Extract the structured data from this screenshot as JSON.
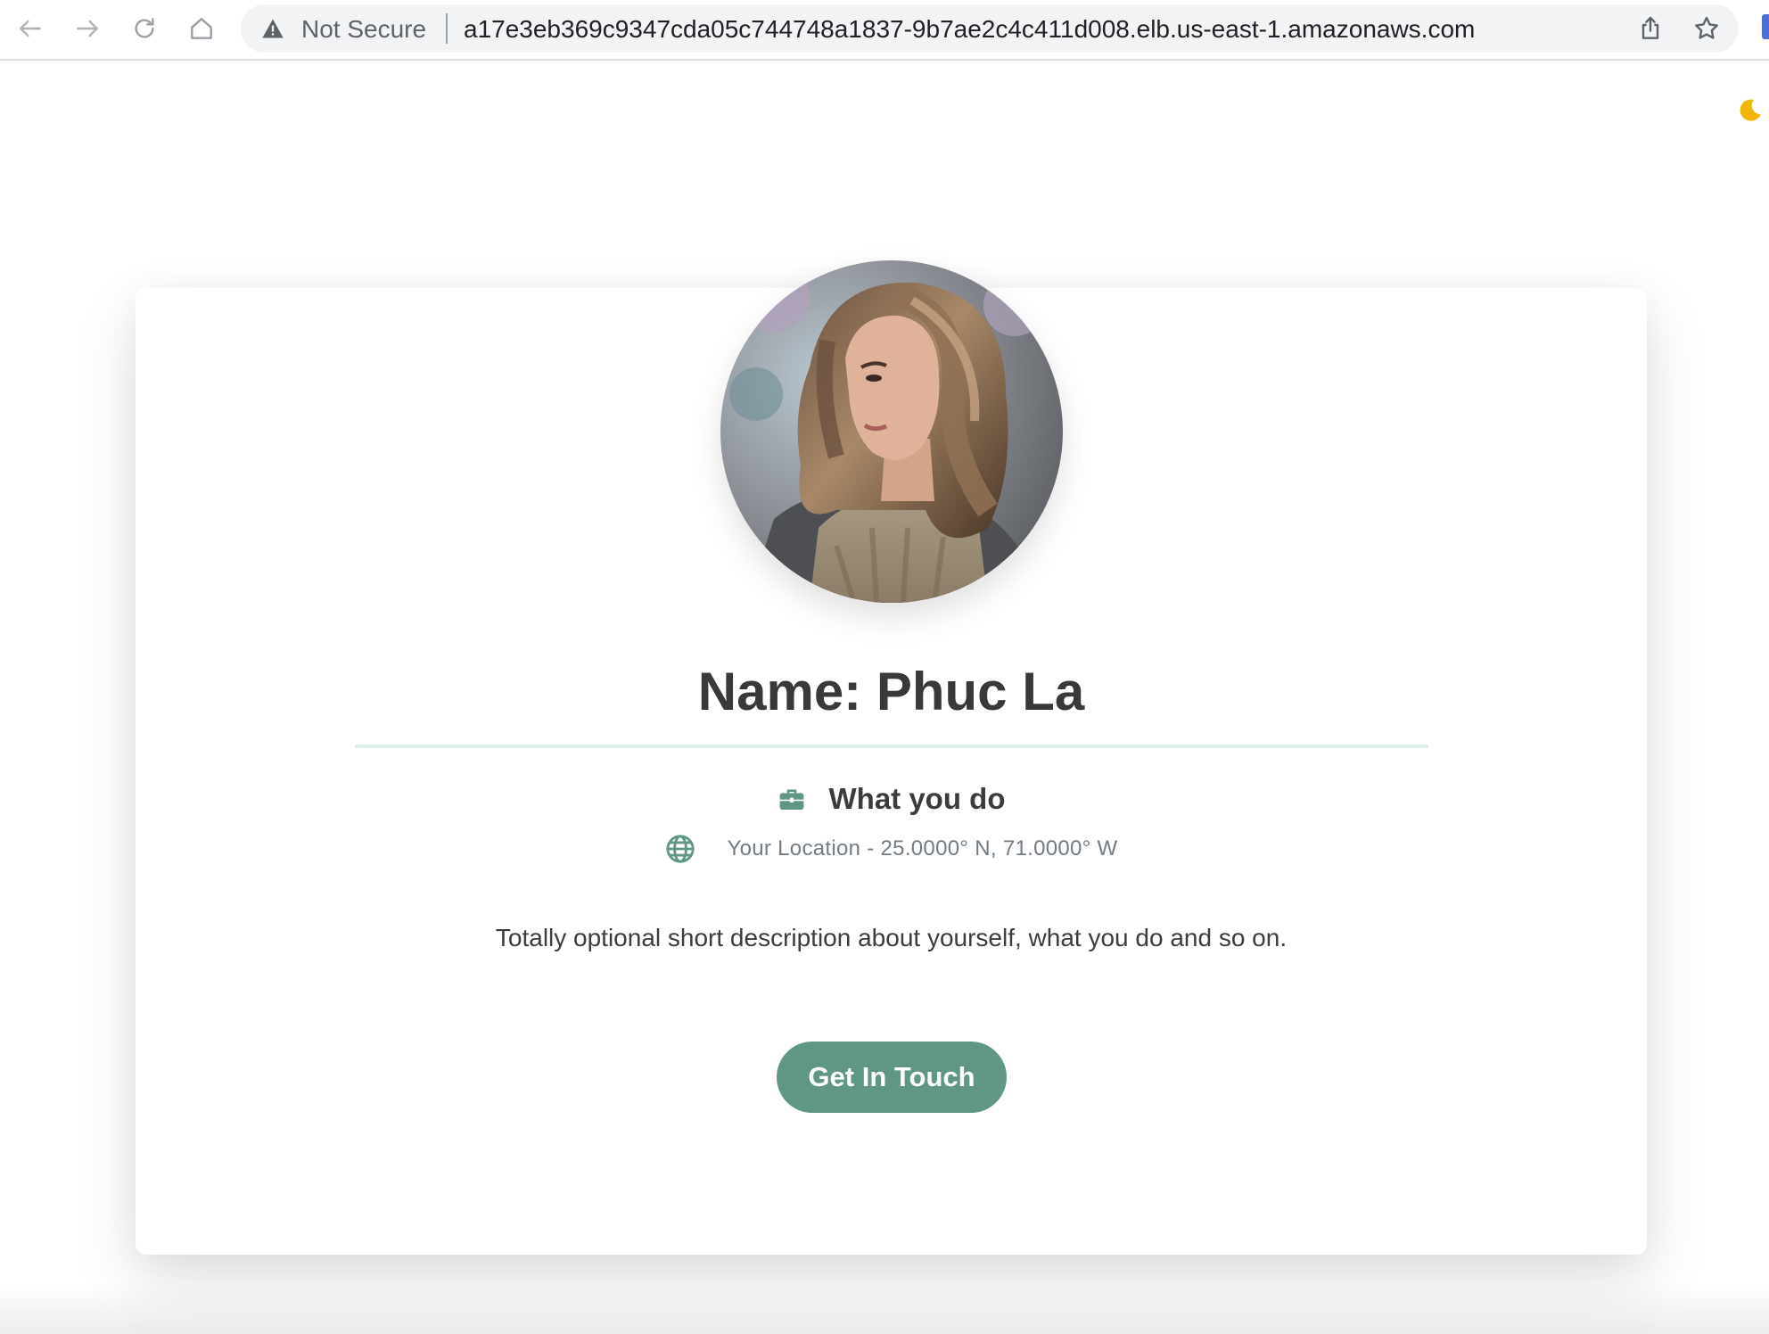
{
  "browser": {
    "security_label": "Not Secure",
    "url": "a17e3eb369c9347cda05c744748a1837-9b7ae2c4c411d008.elb.us-east-1.amazonaws.com"
  },
  "profile": {
    "name": "Name: Phuc La",
    "job": "What you do",
    "location": "Your Location - 25.0000° N, 71.0000° W",
    "description": "Totally optional short description about yourself, what you do and so on.",
    "cta_label": "Get In Touch"
  },
  "colors": {
    "accent": "#5f9782",
    "divider": "#dcefe9",
    "moon": "#f2b705"
  },
  "icons": {
    "theme_toggle": "moon-icon",
    "job": "briefcase-icon",
    "location": "globe-icon"
  }
}
